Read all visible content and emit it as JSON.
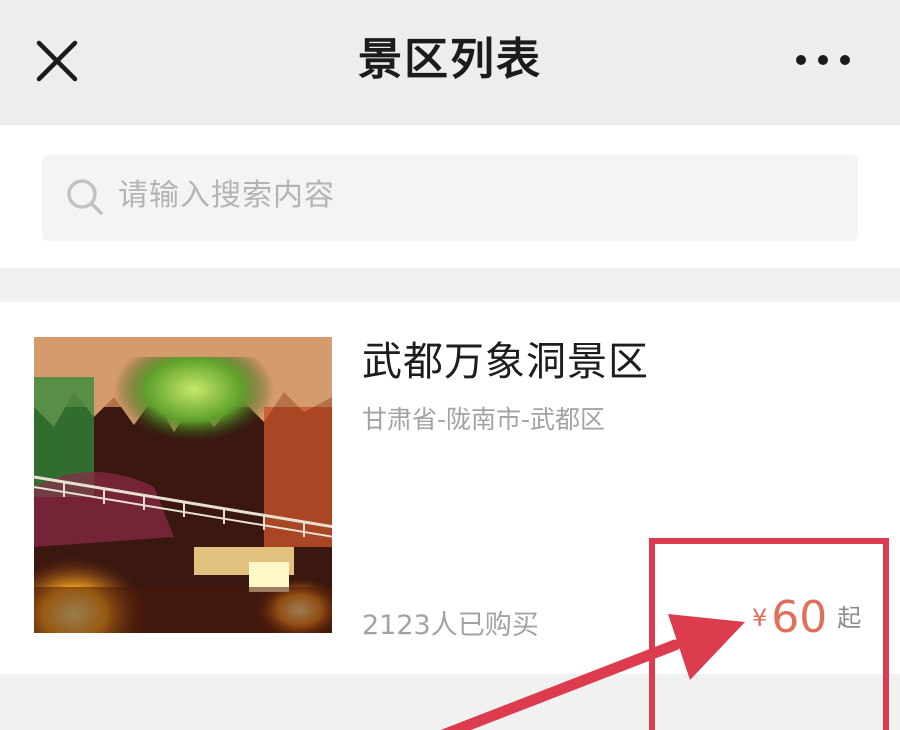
{
  "nav": {
    "title": "景区列表",
    "close_icon": "close-icon",
    "more_icon": "more-dots-icon"
  },
  "search": {
    "placeholder": "请输入搜索内容",
    "icon": "search-icon"
  },
  "spot": {
    "name": "武都万象洞景区",
    "location": "甘肃省-陇南市-武都区",
    "sold": "2123人已购买",
    "currency": "¥",
    "price": "60",
    "price_suffix": "起"
  },
  "colors": {
    "price": "#e0705a",
    "annotation": "#dd3c4e",
    "nav_bg": "#ededed"
  }
}
